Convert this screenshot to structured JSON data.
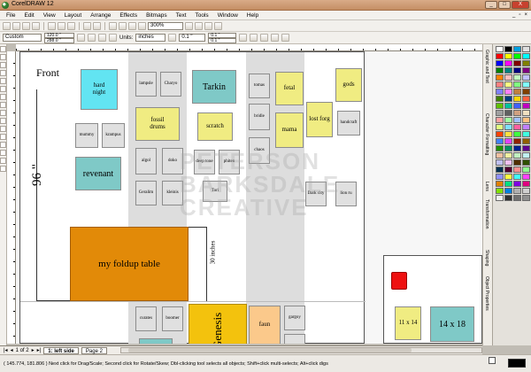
{
  "window": {
    "title": "CorelDRAW 12",
    "min": "_",
    "max": "□",
    "close": "X"
  },
  "menu": [
    "File",
    "Edit",
    "View",
    "Layout",
    "Arrange",
    "Effects",
    "Bitmaps",
    "Text",
    "Tools",
    "Window",
    "Help"
  ],
  "toolbar": {
    "zoom": "300%"
  },
  "propbar": {
    "page_size": "Custom",
    "width": "120.0 \"",
    "height": "288.0 \"",
    "units_label": "Units:",
    "units": "inches",
    "nudge": "0.1 \"",
    "dup_x": "0.1 \"",
    "dup_y": "0.1 \""
  },
  "canvas": {
    "front_label": "Front",
    "dimension_96": "96 \"",
    "dimension_30": "30 inches",
    "watermark": "PETERSON\nBARKSDALE\nCREATIVE",
    "items": {
      "hard_night": "hard\nnight",
      "lampsle": "lampsle",
      "charyo": "Charyo",
      "tarkin": "Tarkin",
      "tomas": "tomas",
      "fetal": "fetal",
      "gods": "gods",
      "mummy": "mummy",
      "krampus": "krampus",
      "fossil_drums": "fossil\ndrums",
      "scratch": "scratch",
      "bridle": "bridle",
      "lost_forg": "lost forg",
      "handcraft": "handcraft",
      "mama": "mama",
      "algol": "algol",
      "doko": "doko",
      "deep_tone": "deep tone",
      "phiten": "phiten",
      "chaos": "chaos",
      "revenant": "revenant",
      "geralim": "Geralim",
      "kleinis": "kleinis",
      "tori": "Tori",
      "dark_city": "Dark city",
      "lion_ru": "lion ru",
      "foldup": "my foldup table",
      "curates": "curates",
      "boomer": "boomer",
      "genesis": "Genesis",
      "faun": "faun",
      "gargoy": "gargoy",
      "eleven14": "11 x 14",
      "fourteen18": "14 x 18"
    }
  },
  "dockers": [
    "Graphic and Text",
    "Character Formatting",
    "Lens",
    "Transformation",
    "Shaping",
    "Object Properties"
  ],
  "palette": [
    "#ffffff",
    "#000000",
    "#00a0e0",
    "#e0e0e0",
    "#ff0000",
    "#ffff00",
    "#00ff00",
    "#00ffff",
    "#0000ff",
    "#ff00ff",
    "#800000",
    "#808000",
    "#008000",
    "#008080",
    "#000080",
    "#800080",
    "#ff8000",
    "#ffc0c0",
    "#c0ffc0",
    "#c0c0ff",
    "#ff8080",
    "#ffff80",
    "#80ff80",
    "#80ffff",
    "#8080ff",
    "#ff80ff",
    "#c08040",
    "#804000",
    "#408000",
    "#004080",
    "#ffd700",
    "#ff6040",
    "#60c000",
    "#00c0a0",
    "#4060ff",
    "#c000c0",
    "#a0a0a0",
    "#606060",
    "#d0a080",
    "#f0e0c0",
    "#ffa0a0",
    "#a0ffa0",
    "#a0c0ff",
    "#ffc080",
    "#e0ff80",
    "#80e0ff",
    "#ff60a0",
    "#c080ff",
    "#ff4000",
    "#ffe040",
    "#40ff40",
    "#40ffe0",
    "#4080ff",
    "#e040ff",
    "#902000",
    "#906000",
    "#209000",
    "#009060",
    "#002090",
    "#600090",
    "#f0c0a0",
    "#f0f0a0",
    "#c0f0c0",
    "#c0f0f0",
    "#c0c0f0",
    "#f0c0f0",
    "#503000",
    "#305000",
    "#003050",
    "#500030",
    "#ff9090",
    "#90ff90",
    "#9090ff",
    "#ffff40",
    "#40ffff",
    "#ff40ff",
    "#e08000",
    "#00e080",
    "#8000e0",
    "#e00080",
    "#80e000",
    "#0080e0",
    "#b0b0b0",
    "#d0d0d0",
    "#f0f0f0",
    "#303030",
    "#707070",
    "#909090"
  ],
  "pages": {
    "counter": "1 of 2",
    "tab1": "1: left side",
    "tab2": "Page 2"
  },
  "status": {
    "coords": "( 145.774, 181.806 )",
    "hint": "Next click for Drag/Scale; Second click for Rotate/Skew; Dbl-clicking tool selects all objects; Shift+click multi-selects; Alt+click digs"
  }
}
